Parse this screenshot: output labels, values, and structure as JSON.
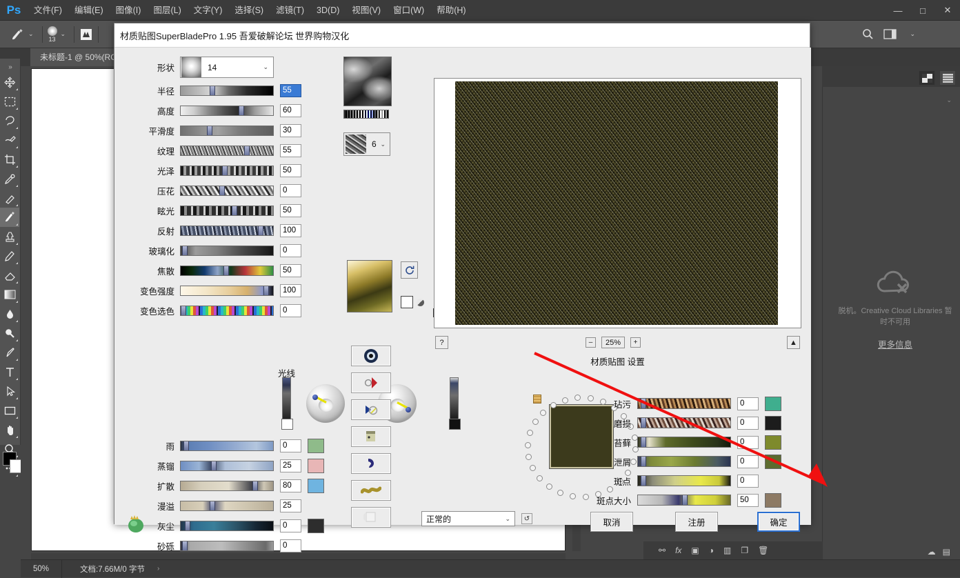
{
  "app": {
    "logo": "Ps",
    "menus": [
      "文件(F)",
      "编辑(E)",
      "图像(I)",
      "图层(L)",
      "文字(Y)",
      "选择(S)",
      "滤镜(T)",
      "3D(D)",
      "视图(V)",
      "窗口(W)",
      "帮助(H)"
    ],
    "window_controls": {
      "minimize": "—",
      "maximize": "□",
      "close": "✕"
    },
    "tab_title": "未标题-1 @ 50%(RG",
    "brush_size": "13",
    "status": {
      "zoom": "50%",
      "doc_info": "文档:7.66M/0 字节",
      "arrow": "›"
    },
    "right_dock": {
      "cc_message": "脱机。Creative Cloud Libraries 暂时不可用",
      "cc_link": "更多信息"
    }
  },
  "dialog": {
    "title": "材质贴图SuperBladePro 1.95 吾爱破解论坛 世界购物汉化",
    "shape": {
      "label": "形状",
      "value": "14"
    },
    "sliders_left": [
      {
        "label": "半径",
        "value": "55",
        "pos": 42,
        "selected": true,
        "grad": "linear-gradient(90deg,#9a9a9a 0%,#b9b9b9 18%,#d8d8d8 34%,#6a6a6a 52%,#2a2a2a 72%,#000 100%)"
      },
      {
        "label": "高度",
        "value": "60",
        "pos": 84,
        "selected": false,
        "grad": "linear-gradient(90deg,#efefef 0%,#cfcfcf 14%,#8a8a8a 30%,#4d4d4d 48%,#2c2c2c 62%,#9b9b9b 80%,#e8e8e8 100%)"
      },
      {
        "label": "平滑度",
        "value": "30",
        "pos": 38,
        "selected": false,
        "grad": "linear-gradient(90deg,#6f6f6f 0%,#8e8e8e 22%,#a2a2a2 40%,#7d7d7d 62%,#6a6a6a 82%,#5e5e5e 100%)"
      },
      {
        "label": "纹理",
        "value": "55",
        "pos": 92,
        "selected": false,
        "grad": "repeating-linear-gradient(70deg,#6c6c6c 0 2px,#aeaeae 2px 4px,#404040 4px 6px,#d6d6d6 6px 8px)"
      },
      {
        "label": "光泽",
        "value": "50",
        "pos": 60,
        "selected": false,
        "grad": "repeating-linear-gradient(90deg,#1c1c1c 0 4px,#9f9f9f 4px 8px,#3b3b3b 8px 13px,#d2d2d2 13px 16px)"
      },
      {
        "label": "压花",
        "value": "0",
        "pos": 56,
        "selected": false,
        "grad": "repeating-linear-gradient(58deg,#2b2b2b 0 3px,#c5c5c5 3px 6px,#6e6e6e 6px 9px,#ededed 9px 12px)"
      },
      {
        "label": "眩光",
        "value": "50",
        "pos": 74,
        "selected": false,
        "grad": "repeating-linear-gradient(90deg,#171717 0 5px,#8d8d8d 5px 9px,#2e2e2e 9px 15px,#cdcdcd 15px 18px)"
      },
      {
        "label": "反射",
        "value": "100",
        "pos": 112,
        "selected": false,
        "grad": "repeating-linear-gradient(80deg,#2a3144 0 3px,#8d97ad 3px 6px,#454f66 6px 10px,#cfd6e4 10px 12px)"
      },
      {
        "label": "玻璃化",
        "value": "0",
        "pos": 2,
        "selected": false,
        "grad": "linear-gradient(90deg,#3d3d3d 0%,#9c9c9c 16%,#7e7e7e 40%,#4b4b4b 66%,#161616 100%)"
      },
      {
        "label": "焦散",
        "value": "50",
        "pos": 62,
        "selected": false,
        "grad": "linear-gradient(90deg,#000 0%,#0a2a0a 12%,#123a6e 26%,#8fa4c8 40%,#0f3a1a 54%,#b9343b 70%,#e0c93a 86%,#2f8f45 100%)"
      },
      {
        "label": "变色强度",
        "value": "100",
        "pos": 120,
        "selected": false,
        "grad": "linear-gradient(90deg,#fdf7e8 0%,#f3e6c8 28%,#e8cf9e 52%,#d6b06c 72%,#8d98c8 88%,#11121a 100%)"
      },
      {
        "label": "变色选色",
        "value": "0",
        "pos": 0,
        "selected": false,
        "grad": "repeating-linear-gradient(90deg,#1c1c2c 0 2px,#2b6fd8 2px 6px,#28b8c9 6px 10px,#3fcf68 10px 14px,#e8e33a 14px 18px,#e0553a 18px 22px,#b84ad1 22px 26px)"
      }
    ],
    "light_header": "光线",
    "sliders_weather": [
      {
        "label": "雨",
        "value": "0",
        "pos": 4,
        "swatch": "#8fbb8a",
        "grad": "linear-gradient(90deg,#2b3040 0%,#5d7fb4 8%,#6f8ec2 30%,#93aad0 58%,#b4c6de 82%,#7e9ac4 100%)"
      },
      {
        "label": "蒸镏",
        "value": "25",
        "pos": 44,
        "swatch": "#e8b6b6",
        "grad": "linear-gradient(90deg,#6f8ec2 0%,#9ab4d6 20%,#3c4a66 33%,#aebfd8 48%,#c6d2e2 74%,#8fa4c4 100%)"
      },
      {
        "label": "扩散",
        "value": "80",
        "pos": 104,
        "swatch": "#6fb4e0",
        "grad": "linear-gradient(90deg,#b5aa93 0%,#d6cfbc 22%,#e3ddcc 52%,#3b3c44 78%,#cfc8b6 90%,#9e9584 100%)"
      },
      {
        "label": "漫溢",
        "value": "25",
        "pos": 42,
        "swatch": "",
        "grad": "linear-gradient(90deg,#c7bda6 0%,#d8cfba 24%,#4a4e6e 34%,#ded6c2 48%,#cbc2ac 76%,#b8ae98 100%)"
      },
      {
        "label": "灰尘",
        "value": "0",
        "pos": 6,
        "swatch": "#2d2d2d",
        "grad": "linear-gradient(90deg,#23354a 0%,#2f6c8e 14%,#3a7f9a 36%,#2c5468 60%,#162634 82%,#0a0f14 100%)"
      },
      {
        "label": "砂砾",
        "value": "0",
        "pos": 2,
        "swatch": "",
        "grad": "linear-gradient(90deg,#2c2c3a 0%,#a9a9a9 10%,#bdbdbd 44%,#8d8d8d 72%,#6a6a6a 92%,#9d9d9d 100%)"
      }
    ],
    "texture_count": "6",
    "preview": {
      "zoom_out": "–",
      "zoom_value": "25%",
      "zoom_in": "+",
      "help": "?",
      "collapse": "▲",
      "settings_title": "材质贴图 设置"
    },
    "sliders_right": [
      {
        "label": "玷污",
        "value": "0",
        "pos": 4,
        "swatch": "#3fae8e",
        "grad": "repeating-linear-gradient(74deg,#5c3a22 0 3px,#b88a55 3px 6px,#2e1b0e 6px 9px,#d8b07a 9px 12px)"
      },
      {
        "label": "磨损",
        "value": "0",
        "pos": 4,
        "swatch": "#1c1c1c",
        "grad": "repeating-linear-gradient(66deg,#6b4a3a 0 3px,#e0d6cc 3px 6px,#3a2420 6px 9px,#c0a696 9px 12px)"
      },
      {
        "label": "苔藓",
        "value": "0",
        "pos": 4,
        "swatch": "#7e8a2c",
        "grad": "linear-gradient(90deg,#2b2f1a 0%,#e6e2cc 12%,#5e6b2a 30%,#3d4a1c 60%,#29331a 86%,#141a0c 100%)"
      },
      {
        "label": "泄屑",
        "value": "0",
        "pos": 4,
        "swatch": "#5c6b2e",
        "grad": "linear-gradient(90deg,#3a3f5c 0%,#7e8a3a 14%,#9aa84a 36%,#6a7a30 62%,#4a5a62 86%,#2a3450 100%)"
      },
      {
        "label": "斑点",
        "value": "0",
        "pos": 4,
        "swatch": "",
        "grad": "linear-gradient(90deg,#23231a 0%,#8d8d7a 16%,#cfcf8a 40%,#e8e84a 68%,#c9c93a 88%,#1a1a12 100%)"
      },
      {
        "label": "斑点大小",
        "value": "50",
        "pos": 64,
        "swatch": "#8d7a64",
        "grad": "linear-gradient(90deg,#dcdcdc 0%,#b8b8b8 26%,#3a3a6e 44%,#e8e84a 62%,#cfcf3a 84%,#6a6a28 100%)"
      }
    ],
    "blend_mode": "正常的",
    "undo_label": "↺",
    "buttons": {
      "cancel": "取消",
      "register": "注册",
      "ok": "确定"
    }
  }
}
